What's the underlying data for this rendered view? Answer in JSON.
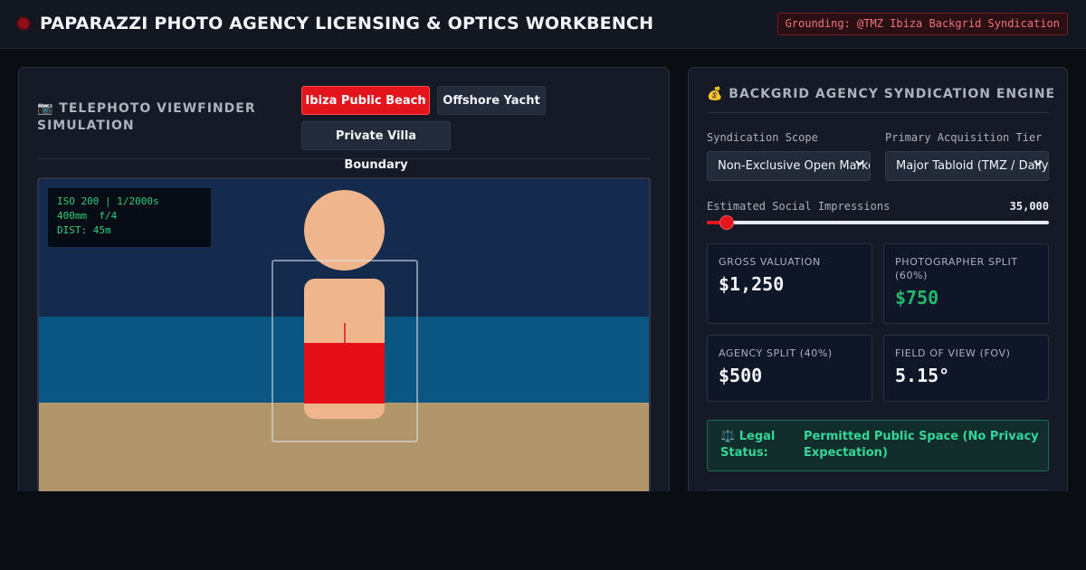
{
  "app": {
    "title": "PAPARAZZI PHOTO AGENCY LICENSING & OPTICS WORKBENCH",
    "grounding": "Grounding: @TMZ Ibiza Backgrid Syndication"
  },
  "viewfinder": {
    "title": "📷 TELEPHOTO VIEWFINDER SIMULATION",
    "locations": [
      {
        "label": "Ibiza Public Beach",
        "active": true
      },
      {
        "label": "Offshore Yacht",
        "active": false
      },
      {
        "label": "Private Villa Boundary",
        "active": false
      }
    ],
    "hud": {
      "line1": "ISO 200 | 1/2000s",
      "line2": "400mm  f/4",
      "line3": "DIST: 45m"
    },
    "colors": {
      "sky": "#142b4e",
      "sea": "#0a5581",
      "sand": "#b0966a",
      "skin": "#efb68e",
      "swimwear": "#e50e19"
    }
  },
  "syndication": {
    "title": "💰 BACKGRID AGENCY SYNDICATION ENGINE",
    "scope": {
      "label": "Syndication Scope",
      "value": "Non-Exclusive Open Market"
    },
    "tier": {
      "label": "Primary Acquisition Tier",
      "value": "Major Tabloid (TMZ / Daily Mail)"
    },
    "impressions": {
      "label": "Estimated Social Impressions",
      "value": "35,000",
      "fraction": 0.04
    },
    "cards": {
      "gross": {
        "label": "GROSS VALUATION",
        "value": "$1,250"
      },
      "photographer": {
        "label": "PHOTOGRAPHER SPLIT (60%)",
        "value": "$750"
      },
      "agency": {
        "label": "AGENCY SPLIT (40%)",
        "value": "$500"
      },
      "fov": {
        "label": "FIELD OF VIEW (FOV)",
        "value": "5.15°"
      }
    },
    "legal": {
      "label": "⚖️ Legal Status:",
      "value": "Permitted Public Space (No Privacy Expectation)"
    },
    "accent": "#e3141c"
  }
}
